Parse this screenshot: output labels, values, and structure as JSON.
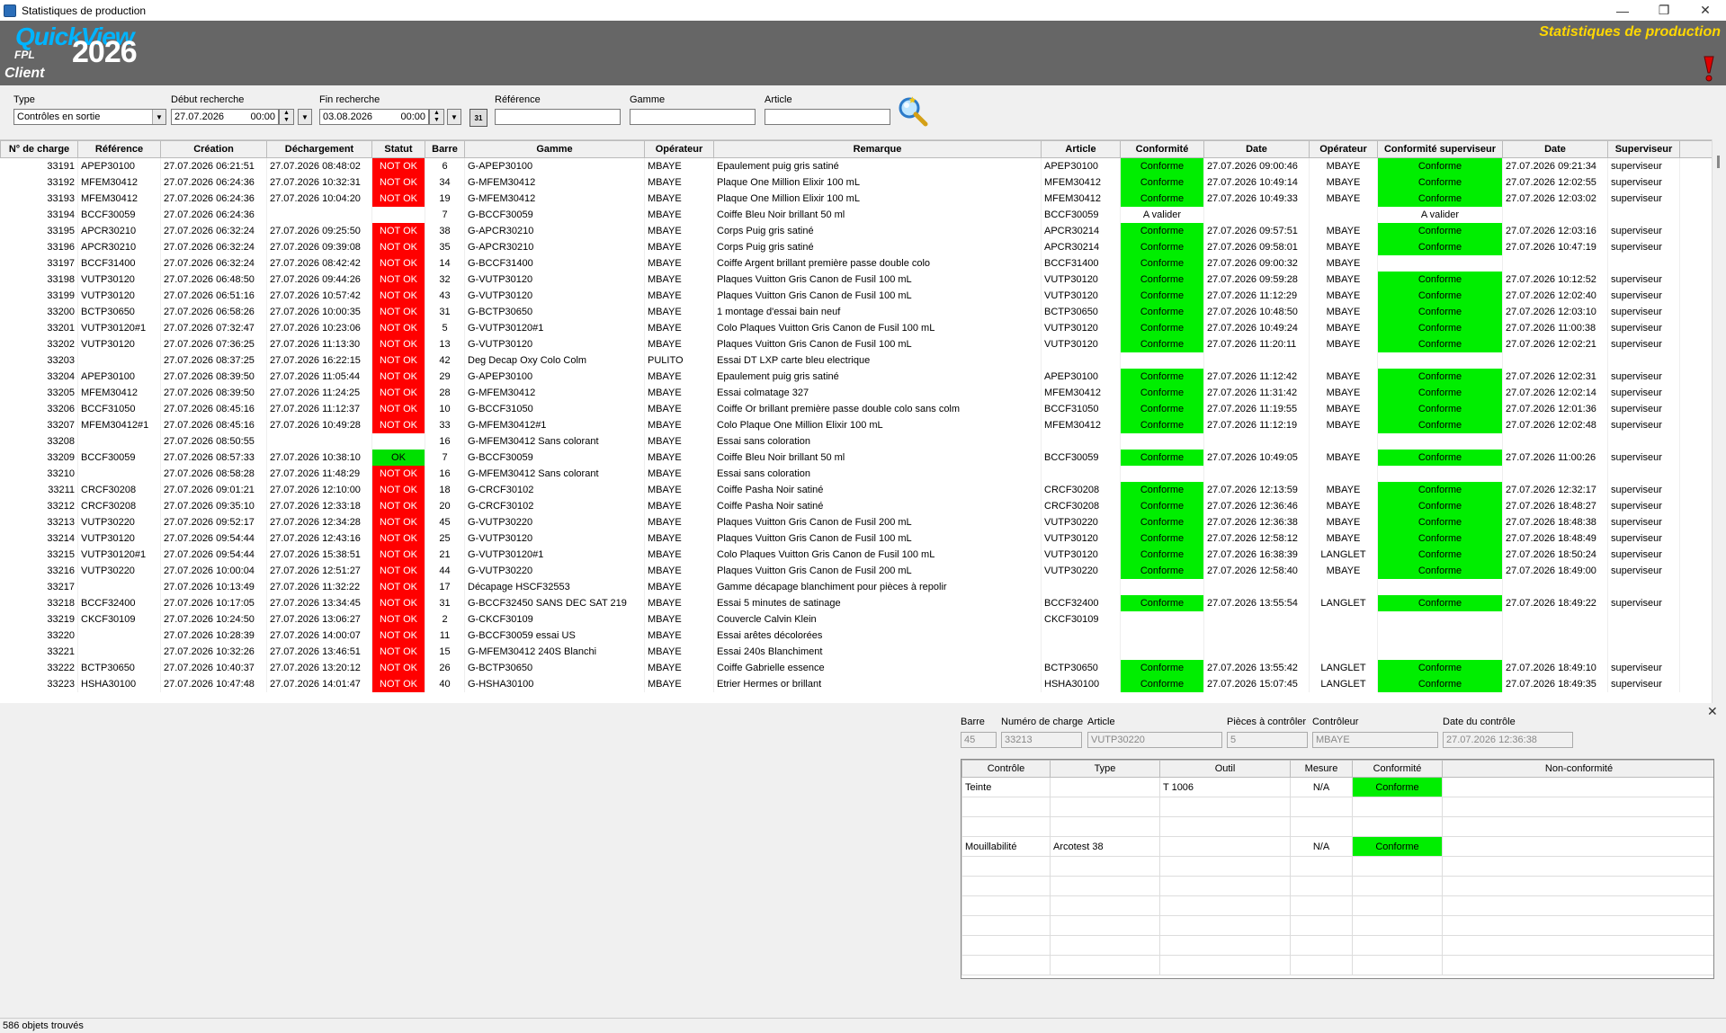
{
  "window": {
    "title": "Statistiques de production"
  },
  "brand": {
    "quick": "QuickView",
    "fpl": "FPL",
    "year": "2026",
    "client": "Client",
    "header_title": "Statistiques de production"
  },
  "filters": {
    "type_label": "Type",
    "type_value": "Contrôles en sortie",
    "debut_label": "Début recherche",
    "debut_date": "27.07.2026",
    "debut_time": "00:00",
    "fin_label": "Fin recherche",
    "fin_date": "03.08.2026",
    "fin_time": "00:00",
    "reference_label": "Référence",
    "reference_value": "",
    "gamme_label": "Gamme",
    "gamme_value": "",
    "article_label": "Article",
    "article_value": "",
    "calendar_label": "31"
  },
  "grid": {
    "columns": [
      "N° de charge",
      "Référence",
      "Création",
      "Déchargement",
      "Statut",
      "Barre",
      "Gamme",
      "Opérateur",
      "Remarque",
      "Article",
      "Conformité",
      "Date",
      "Opérateur",
      "Conformité superviseur",
      "Date",
      "Superviseur"
    ],
    "rows": [
      [
        "33191",
        "APEP30100",
        "27.07.2026 06:21:51",
        "27.07.2026 08:48:02",
        "NOT OK",
        "6",
        "G-APEP30100",
        "MBAYE",
        "Epaulement puig gris satiné",
        "APEP30100",
        "Conforme",
        "27.07.2026 09:00:46",
        "MBAYE",
        "Conforme",
        "27.07.2026 09:21:34",
        "superviseur"
      ],
      [
        "33192",
        "MFEM30412",
        "27.07.2026 06:24:36",
        "27.07.2026 10:32:31",
        "NOT OK",
        "34",
        "G-MFEM30412",
        "MBAYE",
        "Plaque One Million Elixir 100 mL",
        "MFEM30412",
        "Conforme",
        "27.07.2026 10:49:14",
        "MBAYE",
        "Conforme",
        "27.07.2026 12:02:55",
        "superviseur"
      ],
      [
        "33193",
        "MFEM30412",
        "27.07.2026 06:24:36",
        "27.07.2026 10:04:20",
        "NOT OK",
        "19",
        "G-MFEM30412",
        "MBAYE",
        "Plaque One Million Elixir 100 mL",
        "MFEM30412",
        "Conforme",
        "27.07.2026 10:49:33",
        "MBAYE",
        "Conforme",
        "27.07.2026 12:03:02",
        "superviseur"
      ],
      [
        "33194",
        "BCCF30059",
        "27.07.2026 06:24:36",
        "",
        "",
        "7",
        "G-BCCF30059",
        "MBAYE",
        "Coiffe Bleu Noir brillant 50 ml",
        "BCCF30059",
        "A valider",
        "",
        "",
        "A valider",
        "",
        ""
      ],
      [
        "33195",
        "APCR30210",
        "27.07.2026 06:32:24",
        "27.07.2026 09:25:50",
        "NOT OK",
        "38",
        "G-APCR30210",
        "MBAYE",
        "Corps Puig gris satiné",
        "APCR30214",
        "Conforme",
        "27.07.2026 09:57:51",
        "MBAYE",
        "Conforme",
        "27.07.2026 12:03:16",
        "superviseur"
      ],
      [
        "33196",
        "APCR30210",
        "27.07.2026 06:32:24",
        "27.07.2026 09:39:08",
        "NOT OK",
        "35",
        "G-APCR30210",
        "MBAYE",
        "Corps Puig gris satiné",
        "APCR30214",
        "Conforme",
        "27.07.2026 09:58:01",
        "MBAYE",
        "Conforme",
        "27.07.2026 10:47:19",
        "superviseur"
      ],
      [
        "33197",
        "BCCF31400",
        "27.07.2026 06:32:24",
        "27.07.2026 08:42:42",
        "NOT OK",
        "14",
        "G-BCCF31400",
        "MBAYE",
        "Coiffe Argent brillant première passe double colo",
        "BCCF31400",
        "Conforme",
        "27.07.2026 09:00:32",
        "MBAYE",
        "",
        "",
        ""
      ],
      [
        "33198",
        "VUTP30120",
        "27.07.2026 06:48:50",
        "27.07.2026 09:44:26",
        "NOT OK",
        "32",
        "G-VUTP30120",
        "MBAYE",
        "Plaques Vuitton Gris Canon de Fusil 100 mL",
        "VUTP30120",
        "Conforme",
        "27.07.2026 09:59:28",
        "MBAYE",
        "Conforme",
        "27.07.2026 10:12:52",
        "superviseur"
      ],
      [
        "33199",
        "VUTP30120",
        "27.07.2026 06:51:16",
        "27.07.2026 10:57:42",
        "NOT OK",
        "43",
        "G-VUTP30120",
        "MBAYE",
        "Plaques Vuitton Gris Canon de Fusil 100 mL",
        "VUTP30120",
        "Conforme",
        "27.07.2026 11:12:29",
        "MBAYE",
        "Conforme",
        "27.07.2026 12:02:40",
        "superviseur"
      ],
      [
        "33200",
        "BCTP30650",
        "27.07.2026 06:58:26",
        "27.07.2026 10:00:35",
        "NOT OK",
        "31",
        "G-BCTP30650",
        "MBAYE",
        "1 montage d'essai bain neuf",
        "BCTP30650",
        "Conforme",
        "27.07.2026 10:48:50",
        "MBAYE",
        "Conforme",
        "27.07.2026 12:03:10",
        "superviseur"
      ],
      [
        "33201",
        "VUTP30120#1",
        "27.07.2026 07:32:47",
        "27.07.2026 10:23:06",
        "NOT OK",
        "5",
        "G-VUTP30120#1",
        "MBAYE",
        "Colo Plaques Vuitton Gris Canon de Fusil 100 mL",
        "VUTP30120",
        "Conforme",
        "27.07.2026 10:49:24",
        "MBAYE",
        "Conforme",
        "27.07.2026 11:00:38",
        "superviseur"
      ],
      [
        "33202",
        "VUTP30120",
        "27.07.2026 07:36:25",
        "27.07.2026 11:13:30",
        "NOT OK",
        "13",
        "G-VUTP30120",
        "MBAYE",
        "Plaques Vuitton Gris Canon de Fusil 100 mL",
        "VUTP30120",
        "Conforme",
        "27.07.2026 11:20:11",
        "MBAYE",
        "Conforme",
        "27.07.2026 12:02:21",
        "superviseur"
      ],
      [
        "33203",
        "",
        "27.07.2026 08:37:25",
        "27.07.2026 16:22:15",
        "NOT OK",
        "42",
        "Deg Decap Oxy Colo Colm",
        "PULITO",
        "Essai DT LXP carte bleu electrique",
        "",
        "",
        "",
        "",
        "",
        "",
        ""
      ],
      [
        "33204",
        "APEP30100",
        "27.07.2026 08:39:50",
        "27.07.2026 11:05:44",
        "NOT OK",
        "29",
        "G-APEP30100",
        "MBAYE",
        "Epaulement puig gris satiné",
        "APEP30100",
        "Conforme",
        "27.07.2026 11:12:42",
        "MBAYE",
        "Conforme",
        "27.07.2026 12:02:31",
        "superviseur"
      ],
      [
        "33205",
        "MFEM30412",
        "27.07.2026 08:39:50",
        "27.07.2026 11:24:25",
        "NOT OK",
        "28",
        "G-MFEM30412",
        "MBAYE",
        "Essai colmatage 327",
        "MFEM30412",
        "Conforme",
        "27.07.2026 11:31:42",
        "MBAYE",
        "Conforme",
        "27.07.2026 12:02:14",
        "superviseur"
      ],
      [
        "33206",
        "BCCF31050",
        "27.07.2026 08:45:16",
        "27.07.2026 11:12:37",
        "NOT OK",
        "10",
        "G-BCCF31050",
        "MBAYE",
        "Coiffe Or brillant première passe double colo sans colm",
        "BCCF31050",
        "Conforme",
        "27.07.2026 11:19:55",
        "MBAYE",
        "Conforme",
        "27.07.2026 12:01:36",
        "superviseur"
      ],
      [
        "33207",
        "MFEM30412#1",
        "27.07.2026 08:45:16",
        "27.07.2026 10:49:28",
        "NOT OK",
        "33",
        "G-MFEM30412#1",
        "MBAYE",
        "Colo Plaque One Million Elixir 100 mL",
        "MFEM30412",
        "Conforme",
        "27.07.2026 11:12:19",
        "MBAYE",
        "Conforme",
        "27.07.2026 12:02:48",
        "superviseur"
      ],
      [
        "33208",
        "",
        "27.07.2026 08:50:55",
        "",
        "",
        "16",
        "G-MFEM30412 Sans colorant",
        "MBAYE",
        "Essai sans coloration",
        "",
        "",
        "",
        "",
        "",
        "",
        ""
      ],
      [
        "33209",
        "BCCF30059",
        "27.07.2026 08:57:33",
        "27.07.2026 10:38:10",
        "OK",
        "7",
        "G-BCCF30059",
        "MBAYE",
        "Coiffe Bleu Noir brillant 50 ml",
        "BCCF30059",
        "Conforme",
        "27.07.2026 10:49:05",
        "MBAYE",
        "Conforme",
        "27.07.2026 11:00:26",
        "superviseur"
      ],
      [
        "33210",
        "",
        "27.07.2026 08:58:28",
        "27.07.2026 11:48:29",
        "NOT OK",
        "16",
        "G-MFEM30412 Sans colorant",
        "MBAYE",
        "Essai sans coloration",
        "",
        "",
        "",
        "",
        "",
        "",
        ""
      ],
      [
        "33211",
        "CRCF30208",
        "27.07.2026 09:01:21",
        "27.07.2026 12:10:00",
        "NOT OK",
        "18",
        "G-CRCF30102",
        "MBAYE",
        "Coiffe Pasha Noir satiné",
        "CRCF30208",
        "Conforme",
        "27.07.2026 12:13:59",
        "MBAYE",
        "Conforme",
        "27.07.2026 12:32:17",
        "superviseur"
      ],
      [
        "33212",
        "CRCF30208",
        "27.07.2026 09:35:10",
        "27.07.2026 12:33:18",
        "NOT OK",
        "20",
        "G-CRCF30102",
        "MBAYE",
        "Coiffe Pasha Noir satiné",
        "CRCF30208",
        "Conforme",
        "27.07.2026 12:36:46",
        "MBAYE",
        "Conforme",
        "27.07.2026 18:48:27",
        "superviseur"
      ],
      [
        "33213",
        "VUTP30220",
        "27.07.2026 09:52:17",
        "27.07.2026 12:34:28",
        "NOT OK",
        "45",
        "G-VUTP30220",
        "MBAYE",
        "Plaques Vuitton Gris Canon de Fusil 200 mL",
        "VUTP30220",
        "Conforme",
        "27.07.2026 12:36:38",
        "MBAYE",
        "Conforme",
        "27.07.2026 18:48:38",
        "superviseur"
      ],
      [
        "33214",
        "VUTP30120",
        "27.07.2026 09:54:44",
        "27.07.2026 12:43:16",
        "NOT OK",
        "25",
        "G-VUTP30120",
        "MBAYE",
        "Plaques Vuitton Gris Canon de Fusil 100 mL",
        "VUTP30120",
        "Conforme",
        "27.07.2026 12:58:12",
        "MBAYE",
        "Conforme",
        "27.07.2026 18:48:49",
        "superviseur"
      ],
      [
        "33215",
        "VUTP30120#1",
        "27.07.2026 09:54:44",
        "27.07.2026 15:38:51",
        "NOT OK",
        "21",
        "G-VUTP30120#1",
        "MBAYE",
        "Colo Plaques Vuitton Gris Canon de Fusil 100 mL",
        "VUTP30120",
        "Conforme",
        "27.07.2026 16:38:39",
        "LANGLET",
        "Conforme",
        "27.07.2026 18:50:24",
        "superviseur"
      ],
      [
        "33216",
        "VUTP30220",
        "27.07.2026 10:00:04",
        "27.07.2026 12:51:27",
        "NOT OK",
        "44",
        "G-VUTP30220",
        "MBAYE",
        "Plaques Vuitton Gris Canon de Fusil 200 mL",
        "VUTP30220",
        "Conforme",
        "27.07.2026 12:58:40",
        "MBAYE",
        "Conforme",
        "27.07.2026 18:49:00",
        "superviseur"
      ],
      [
        "33217",
        "",
        "27.07.2026 10:13:49",
        "27.07.2026 11:32:22",
        "NOT OK",
        "17",
        "Décapage HSCF32553",
        "MBAYE",
        "Gamme décapage blanchiment pour pièces à repolir",
        "",
        "",
        "",
        "",
        "",
        "",
        ""
      ],
      [
        "33218",
        "BCCF32400",
        "27.07.2026 10:17:05",
        "27.07.2026 13:34:45",
        "NOT OK",
        "31",
        "G-BCCF32450 SANS DEC SAT 219",
        "MBAYE",
        "Essai 5 minutes de satinage",
        "BCCF32400",
        "Conforme",
        "27.07.2026 13:55:54",
        "LANGLET",
        "Conforme",
        "27.07.2026 18:49:22",
        "superviseur"
      ],
      [
        "33219",
        "CKCF30109",
        "27.07.2026 10:24:50",
        "27.07.2026 13:06:27",
        "NOT OK",
        "2",
        "G-CKCF30109",
        "MBAYE",
        "Couvercle Calvin Klein",
        "CKCF30109",
        "",
        "",
        "",
        "",
        "",
        ""
      ],
      [
        "33220",
        "",
        "27.07.2026 10:28:39",
        "27.07.2026 14:00:07",
        "NOT OK",
        "11",
        "G-BCCF30059 essai US",
        "MBAYE",
        "Essai arêtes décolorées",
        "",
        "",
        "",
        "",
        "",
        "",
        ""
      ],
      [
        "33221",
        "",
        "27.07.2026 10:32:26",
        "27.07.2026 13:46:51",
        "NOT OK",
        "15",
        "G-MFEM30412 240S Blanchi",
        "MBAYE",
        "Essai 240s Blanchiment",
        "",
        "",
        "",
        "",
        "",
        "",
        ""
      ],
      [
        "33222",
        "BCTP30650",
        "27.07.2026 10:40:37",
        "27.07.2026 13:20:12",
        "NOT OK",
        "26",
        "G-BCTP30650",
        "MBAYE",
        "Coiffe Gabrielle essence",
        "BCTP30650",
        "Conforme",
        "27.07.2026 13:55:42",
        "LANGLET",
        "Conforme",
        "27.07.2026 18:49:10",
        "superviseur"
      ],
      [
        "33223",
        "HSHA30100",
        "27.07.2026 10:47:48",
        "27.07.2026 14:01:47",
        "NOT OK",
        "40",
        "G-HSHA30100",
        "MBAYE",
        "Etrier Hermes or brillant",
        "HSHA30100",
        "Conforme",
        "27.07.2026 15:07:45",
        "LANGLET",
        "Conforme",
        "27.07.2026 18:49:35",
        "superviseur"
      ]
    ]
  },
  "detail": {
    "barre_label": "Barre",
    "barre_value": "45",
    "charge_label": "Numéro de charge",
    "charge_value": "33213",
    "article_label": "Article",
    "article_value": "VUTP30220",
    "pieces_label": "Pièces à contrôler",
    "pieces_value": "5",
    "controleur_label": "Contrôleur",
    "controleur_value": "MBAYE",
    "date_label": "Date du contrôle",
    "date_value": "27.07.2026 12:36:38",
    "columns": [
      "Contrôle",
      "Type",
      "Outil",
      "Mesure",
      "Conformité",
      "Non-conformité"
    ],
    "rows": [
      [
        "Teinte",
        "",
        "T 1006",
        "N/A",
        "Conforme",
        ""
      ],
      [
        "",
        "",
        "",
        "",
        "",
        ""
      ],
      [
        "",
        "",
        "",
        "",
        "",
        ""
      ],
      [
        "Mouillabilité",
        "Arcotest 38",
        "",
        "N/A",
        "Conforme",
        ""
      ],
      [
        "",
        "",
        "",
        "",
        "",
        ""
      ],
      [
        "",
        "",
        "",
        "",
        "",
        ""
      ],
      [
        "",
        "",
        "",
        "",
        "",
        ""
      ],
      [
        "",
        "",
        "",
        "",
        "",
        ""
      ],
      [
        "",
        "",
        "",
        "",
        "",
        ""
      ],
      [
        "",
        "",
        "",
        "",
        "",
        ""
      ]
    ]
  },
  "status": {
    "text": "586 objets trouvés"
  },
  "colors": {
    "not_ok": "#ff0000",
    "ok": "#00e000",
    "conforme": "#00ee00",
    "header_bg": "#666666",
    "brand_blue": "#00b4ff",
    "title_yellow": "#ffd700"
  }
}
